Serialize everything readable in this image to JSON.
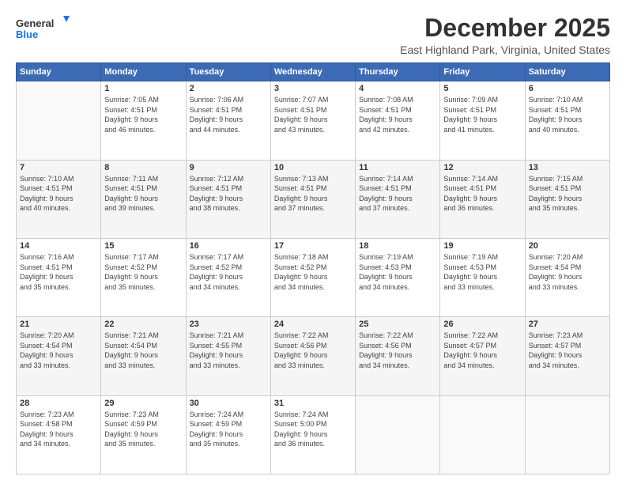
{
  "header": {
    "logo_line1": "General",
    "logo_line2": "Blue",
    "title": "December 2025",
    "subtitle": "East Highland Park, Virginia, United States"
  },
  "days_of_week": [
    "Sunday",
    "Monday",
    "Tuesday",
    "Wednesday",
    "Thursday",
    "Friday",
    "Saturday"
  ],
  "weeks": [
    [
      {
        "day": "",
        "info": ""
      },
      {
        "day": "1",
        "info": "Sunrise: 7:05 AM\nSunset: 4:51 PM\nDaylight: 9 hours\nand 46 minutes."
      },
      {
        "day": "2",
        "info": "Sunrise: 7:06 AM\nSunset: 4:51 PM\nDaylight: 9 hours\nand 44 minutes."
      },
      {
        "day": "3",
        "info": "Sunrise: 7:07 AM\nSunset: 4:51 PM\nDaylight: 9 hours\nand 43 minutes."
      },
      {
        "day": "4",
        "info": "Sunrise: 7:08 AM\nSunset: 4:51 PM\nDaylight: 9 hours\nand 42 minutes."
      },
      {
        "day": "5",
        "info": "Sunrise: 7:09 AM\nSunset: 4:51 PM\nDaylight: 9 hours\nand 41 minutes."
      },
      {
        "day": "6",
        "info": "Sunrise: 7:10 AM\nSunset: 4:51 PM\nDaylight: 9 hours\nand 40 minutes."
      }
    ],
    [
      {
        "day": "7",
        "info": "Sunrise: 7:10 AM\nSunset: 4:51 PM\nDaylight: 9 hours\nand 40 minutes."
      },
      {
        "day": "8",
        "info": "Sunrise: 7:11 AM\nSunset: 4:51 PM\nDaylight: 9 hours\nand 39 minutes."
      },
      {
        "day": "9",
        "info": "Sunrise: 7:12 AM\nSunset: 4:51 PM\nDaylight: 9 hours\nand 38 minutes."
      },
      {
        "day": "10",
        "info": "Sunrise: 7:13 AM\nSunset: 4:51 PM\nDaylight: 9 hours\nand 37 minutes."
      },
      {
        "day": "11",
        "info": "Sunrise: 7:14 AM\nSunset: 4:51 PM\nDaylight: 9 hours\nand 37 minutes."
      },
      {
        "day": "12",
        "info": "Sunrise: 7:14 AM\nSunset: 4:51 PM\nDaylight: 9 hours\nand 36 minutes."
      },
      {
        "day": "13",
        "info": "Sunrise: 7:15 AM\nSunset: 4:51 PM\nDaylight: 9 hours\nand 35 minutes."
      }
    ],
    [
      {
        "day": "14",
        "info": "Sunrise: 7:16 AM\nSunset: 4:51 PM\nDaylight: 9 hours\nand 35 minutes."
      },
      {
        "day": "15",
        "info": "Sunrise: 7:17 AM\nSunset: 4:52 PM\nDaylight: 9 hours\nand 35 minutes."
      },
      {
        "day": "16",
        "info": "Sunrise: 7:17 AM\nSunset: 4:52 PM\nDaylight: 9 hours\nand 34 minutes."
      },
      {
        "day": "17",
        "info": "Sunrise: 7:18 AM\nSunset: 4:52 PM\nDaylight: 9 hours\nand 34 minutes."
      },
      {
        "day": "18",
        "info": "Sunrise: 7:19 AM\nSunset: 4:53 PM\nDaylight: 9 hours\nand 34 minutes."
      },
      {
        "day": "19",
        "info": "Sunrise: 7:19 AM\nSunset: 4:53 PM\nDaylight: 9 hours\nand 33 minutes."
      },
      {
        "day": "20",
        "info": "Sunrise: 7:20 AM\nSunset: 4:54 PM\nDaylight: 9 hours\nand 33 minutes."
      }
    ],
    [
      {
        "day": "21",
        "info": "Sunrise: 7:20 AM\nSunset: 4:54 PM\nDaylight: 9 hours\nand 33 minutes."
      },
      {
        "day": "22",
        "info": "Sunrise: 7:21 AM\nSunset: 4:54 PM\nDaylight: 9 hours\nand 33 minutes."
      },
      {
        "day": "23",
        "info": "Sunrise: 7:21 AM\nSunset: 4:55 PM\nDaylight: 9 hours\nand 33 minutes."
      },
      {
        "day": "24",
        "info": "Sunrise: 7:22 AM\nSunset: 4:56 PM\nDaylight: 9 hours\nand 33 minutes."
      },
      {
        "day": "25",
        "info": "Sunrise: 7:22 AM\nSunset: 4:56 PM\nDaylight: 9 hours\nand 34 minutes."
      },
      {
        "day": "26",
        "info": "Sunrise: 7:22 AM\nSunset: 4:57 PM\nDaylight: 9 hours\nand 34 minutes."
      },
      {
        "day": "27",
        "info": "Sunrise: 7:23 AM\nSunset: 4:57 PM\nDaylight: 9 hours\nand 34 minutes."
      }
    ],
    [
      {
        "day": "28",
        "info": "Sunrise: 7:23 AM\nSunset: 4:58 PM\nDaylight: 9 hours\nand 34 minutes."
      },
      {
        "day": "29",
        "info": "Sunrise: 7:23 AM\nSunset: 4:59 PM\nDaylight: 9 hours\nand 35 minutes."
      },
      {
        "day": "30",
        "info": "Sunrise: 7:24 AM\nSunset: 4:59 PM\nDaylight: 9 hours\nand 35 minutes."
      },
      {
        "day": "31",
        "info": "Sunrise: 7:24 AM\nSunset: 5:00 PM\nDaylight: 9 hours\nand 36 minutes."
      },
      {
        "day": "",
        "info": ""
      },
      {
        "day": "",
        "info": ""
      },
      {
        "day": "",
        "info": ""
      }
    ]
  ]
}
